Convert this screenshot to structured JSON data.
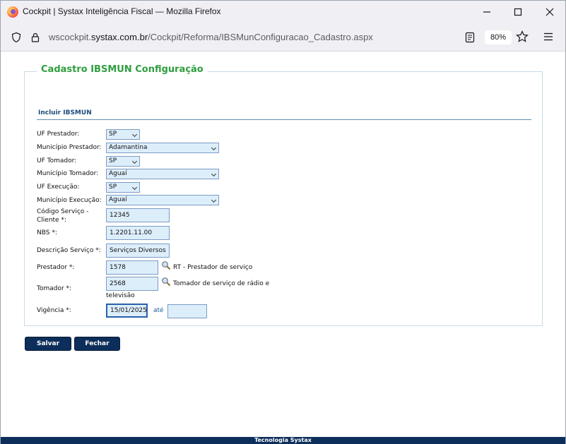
{
  "window": {
    "title": "Cockpit | Systax Inteligência Fiscal — Mozilla Firefox"
  },
  "browser": {
    "url_prefix": "wscockpit.",
    "url_host": "systax.com.br",
    "url_path": "/Cockpit/Reforma/IBSMunConfiguracao_Cadastro.aspx",
    "zoom": "80%"
  },
  "form": {
    "legend": "Cadastro IBSMUN Configuração",
    "section": "Incluir IBSMUN",
    "uf_prestador": {
      "label": "UF Prestador:",
      "value": "SP"
    },
    "municipio_prestador": {
      "label": "Município Prestador:",
      "value": "Adamantina"
    },
    "uf_tomador": {
      "label": "UF Tomador:",
      "value": "SP"
    },
    "municipio_tomador": {
      "label": "Município Tomador:",
      "value": "Aguaí"
    },
    "uf_execucao": {
      "label": "UF Execução:",
      "value": "SP"
    },
    "municipio_execucao": {
      "label": "Município Execução:",
      "value": "Aguaí"
    },
    "codigo_servico": {
      "label_line1": "Código Serviço -",
      "label_line2": "Cliente *:",
      "value": "12345"
    },
    "nbs": {
      "label": "NBS *:",
      "value": "1.2201.11.00"
    },
    "descricao": {
      "label": "Descrição Serviço *:",
      "value": "Serviços Diversos"
    },
    "prestador": {
      "label": "Prestador *:",
      "value": "1578",
      "description": "RT - Prestador de serviço"
    },
    "tomador": {
      "label": "Tomador *:",
      "value": "2568",
      "description_line1": "Tomador de serviço de rádio e",
      "description_line2": "televisão"
    },
    "vigencia": {
      "label": "Vigência *:",
      "value": "15/01/2025",
      "ate_label": "até",
      "end_value": ""
    }
  },
  "buttons": {
    "save": "Salvar",
    "close": "Fechar"
  },
  "footer": "Tecnologia Systax"
}
